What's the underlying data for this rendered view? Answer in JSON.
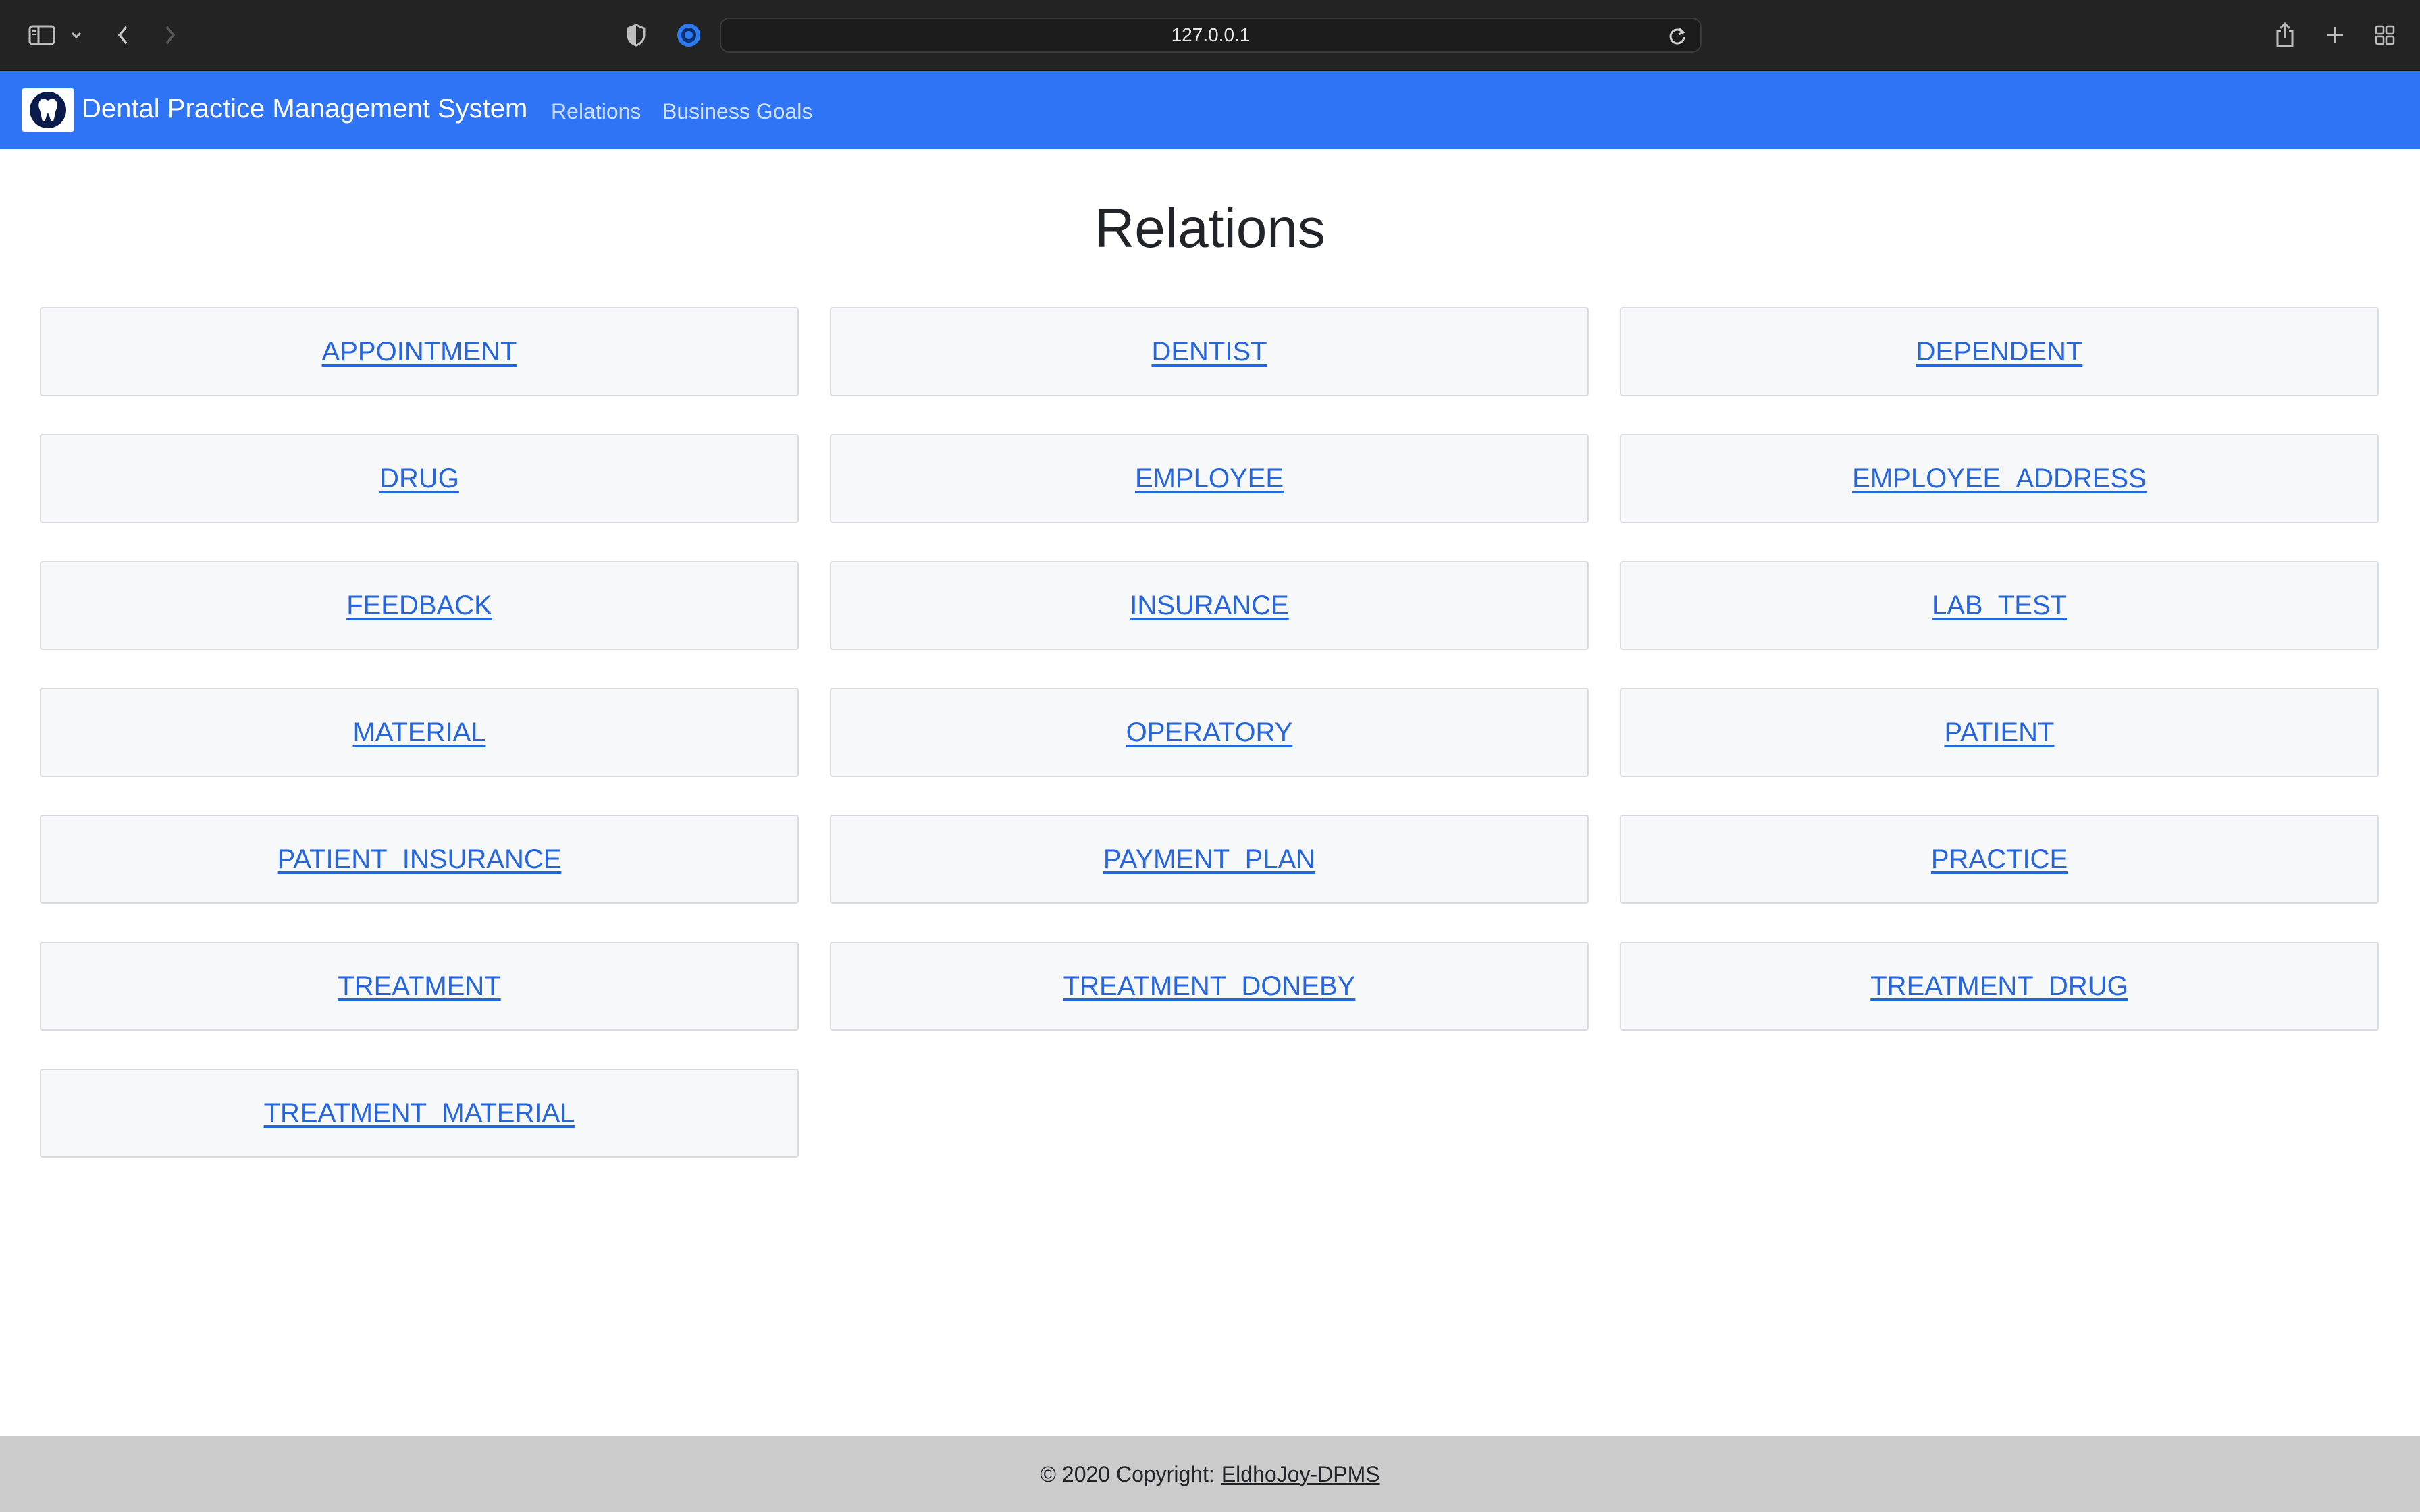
{
  "browser": {
    "url": "127.0.0.1"
  },
  "navbar": {
    "brand": "Dental Practice Management System",
    "links": [
      {
        "label": "Relations"
      },
      {
        "label": "Business Goals"
      }
    ]
  },
  "main": {
    "title": "Relations",
    "relations": [
      "APPOINTMENT",
      "DENTIST",
      "DEPENDENT",
      "DRUG",
      "EMPLOYEE",
      "EMPLOYEE_ADDRESS",
      "FEEDBACK",
      "INSURANCE",
      "LAB_TEST",
      "MATERIAL",
      "OPERATORY",
      "PATIENT",
      "PATIENT_INSURANCE",
      "PAYMENT_PLAN",
      "PRACTICE",
      "TREATMENT",
      "TREATMENT_DONEBY",
      "TREATMENT_DRUG",
      "TREATMENT_MATERIAL"
    ]
  },
  "footer": {
    "copyright": "© 2020 Copyright:",
    "link": "EldhoJoy-DPMS"
  },
  "colors": {
    "navbar": "#2f74f5",
    "link": "#2566e0",
    "footer": "#cbcbcb"
  },
  "icons": [
    "sidebar-icon",
    "chevron-down-icon",
    "back-icon",
    "forward-icon",
    "shield-icon",
    "extension-icon",
    "reload-icon",
    "share-icon",
    "new-tab-icon",
    "tab-overview-icon",
    "tooth-icon"
  ]
}
